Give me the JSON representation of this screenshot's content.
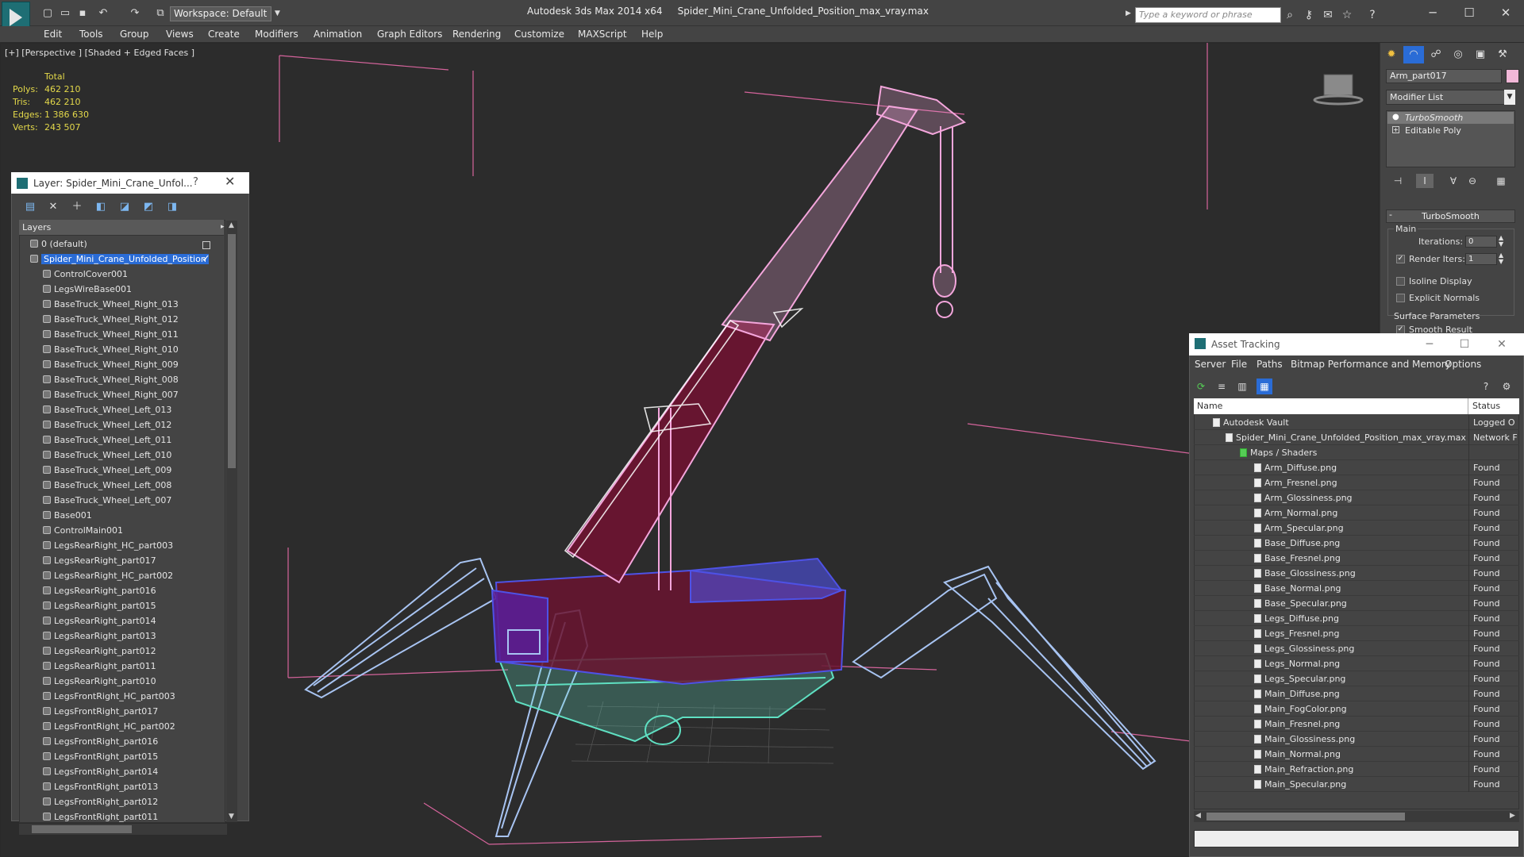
{
  "titlebar": {
    "workspace": "Workspace: Default",
    "app_name": "Autodesk 3ds Max  2014 x64",
    "file_name": "Spider_Mini_Crane_Unfolded_Position_max_vray.max",
    "search_placeholder": "Type a keyword or phrase"
  },
  "menu": [
    "Edit",
    "Tools",
    "Group",
    "Views",
    "Create",
    "Modifiers",
    "Animation",
    "Graph Editors",
    "Rendering",
    "Customize",
    "MAXScript",
    "Help"
  ],
  "viewport": {
    "label": "[+] [Perspective ] [Shaded + Edged Faces ]",
    "stats": {
      "header": "Total",
      "polys_label": "Polys:",
      "polys": "462 210",
      "tris_label": "Tris:",
      "tris": "462 210",
      "edges_label": "Edges:",
      "edges": "1 386 630",
      "verts_label": "Verts:",
      "verts": "243 507"
    }
  },
  "layer_panel": {
    "title": "Layer: Spider_Mini_Crane_Unfol...",
    "help": "?",
    "header": "Layers",
    "layers": [
      "0 (default)",
      "Spider_Mini_Crane_Unfolded_Position",
      "ControlCover001",
      "LegsWireBase001",
      "BaseTruck_Wheel_Right_013",
      "BaseTruck_Wheel_Right_012",
      "BaseTruck_Wheel_Right_011",
      "BaseTruck_Wheel_Right_010",
      "BaseTruck_Wheel_Right_009",
      "BaseTruck_Wheel_Right_008",
      "BaseTruck_Wheel_Right_007",
      "BaseTruck_Wheel_Left_013",
      "BaseTruck_Wheel_Left_012",
      "BaseTruck_Wheel_Left_011",
      "BaseTruck_Wheel_Left_010",
      "BaseTruck_Wheel_Left_009",
      "BaseTruck_Wheel_Left_008",
      "BaseTruck_Wheel_Left_007",
      "Base001",
      "ControlMain001",
      "LegsRearRight_HC_part003",
      "LegsRearRight_part017",
      "LegsRearRight_HC_part002",
      "LegsRearRight_part016",
      "LegsRearRight_part015",
      "LegsRearRight_part014",
      "LegsRearRight_part013",
      "LegsRearRight_part012",
      "LegsRearRight_part011",
      "LegsRearRight_part010",
      "LegsFrontRight_HC_part003",
      "LegsFrontRight_part017",
      "LegsFrontRight_HC_part002",
      "LegsFrontRight_part016",
      "LegsFrontRight_part015",
      "LegsFrontRight_part014",
      "LegsFrontRight_part013",
      "LegsFrontRight_part012",
      "LegsFrontRight_part011"
    ]
  },
  "command_panel": {
    "object_name": "Arm_part017",
    "modifier_list": "Modifier List",
    "stack": [
      "TurboSmooth",
      "Editable Poly"
    ],
    "rollout_title": "TurboSmooth",
    "main_label": "Main",
    "iterations_label": "Iterations:",
    "iterations": "0",
    "render_iters_label": "Render Iters:",
    "render_iters": "1",
    "isoline_label": "Isoline Display",
    "explicit_normals_label": "Explicit Normals",
    "surface_params_label": "Surface Parameters",
    "smooth_result_label": "Smooth Result"
  },
  "asset_tracking": {
    "title": "Asset Tracking",
    "menu": [
      "Server",
      "File",
      "Paths",
      "Bitmap Performance and Memory",
      "Options"
    ],
    "col_name": "Name",
    "col_status": "Status",
    "rows": [
      {
        "name": "Autodesk Vault",
        "status": "Logged O"
      },
      {
        "name": "Spider_Mini_Crane_Unfolded_Position_max_vray.max",
        "status": "Network F"
      },
      {
        "name": "Maps / Shaders",
        "status": ""
      },
      {
        "name": "Arm_Diffuse.png",
        "status": "Found"
      },
      {
        "name": "Arm_Fresnel.png",
        "status": "Found"
      },
      {
        "name": "Arm_Glossiness.png",
        "status": "Found"
      },
      {
        "name": "Arm_Normal.png",
        "status": "Found"
      },
      {
        "name": "Arm_Specular.png",
        "status": "Found"
      },
      {
        "name": "Base_Diffuse.png",
        "status": "Found"
      },
      {
        "name": "Base_Fresnel.png",
        "status": "Found"
      },
      {
        "name": "Base_Glossiness.png",
        "status": "Found"
      },
      {
        "name": "Base_Normal.png",
        "status": "Found"
      },
      {
        "name": "Base_Specular.png",
        "status": "Found"
      },
      {
        "name": "Legs_Diffuse.png",
        "status": "Found"
      },
      {
        "name": "Legs_Fresnel.png",
        "status": "Found"
      },
      {
        "name": "Legs_Glossiness.png",
        "status": "Found"
      },
      {
        "name": "Legs_Normal.png",
        "status": "Found"
      },
      {
        "name": "Legs_Specular.png",
        "status": "Found"
      },
      {
        "name": "Main_Diffuse.png",
        "status": "Found"
      },
      {
        "name": "Main_FogColor.png",
        "status": "Found"
      },
      {
        "name": "Main_Fresnel.png",
        "status": "Found"
      },
      {
        "name": "Main_Glossiness.png",
        "status": "Found"
      },
      {
        "name": "Main_Normal.png",
        "status": "Found"
      },
      {
        "name": "Main_Refraction.png",
        "status": "Found"
      },
      {
        "name": "Main_Specular.png",
        "status": "Found"
      }
    ]
  },
  "colors": {
    "wire_pink": "#f4a6dc",
    "body_dark_red": "#6a1430",
    "wire_blue": "#4e52e6",
    "legs_lightblue": "#a8c4f2",
    "tracks_cyan": "#5fe0c2",
    "selection_blue": "#2a6cd6"
  }
}
